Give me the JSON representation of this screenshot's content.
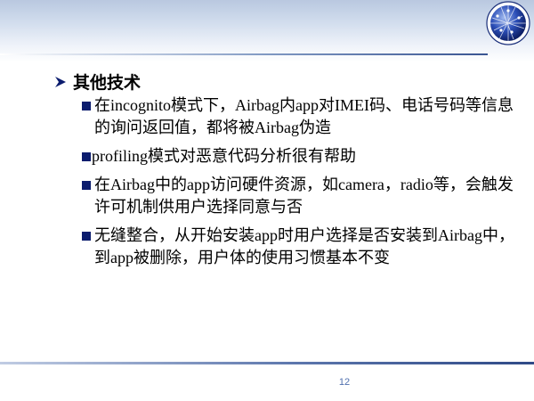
{
  "slide": {
    "heading": "其他技术",
    "bullets": [
      "在incognito模式下，Airbag内app对IMEI码、电话号码等信息的询问返回值，都将被Airbag伪造",
      "profiling模式对恶意代码分析很有帮助",
      "在Airbag中的app访问硬件资源，如camera，radio等，会触发许可机制供用户选择同意与否",
      "无缝整合，从开始安装app时用户选择是否安装到Airbag中，到app被删除，用户体的使用习惯基本不变"
    ],
    "page_number": "12"
  },
  "icons": {
    "logo": "globe-logo-icon",
    "heading_bullet": "arrow-bullet-icon",
    "item_bullet": "square-bullet-icon"
  },
  "colors": {
    "bullet": "#0b1c6e",
    "accent_line": "#3a5592",
    "page_number": "#4f6fae"
  }
}
